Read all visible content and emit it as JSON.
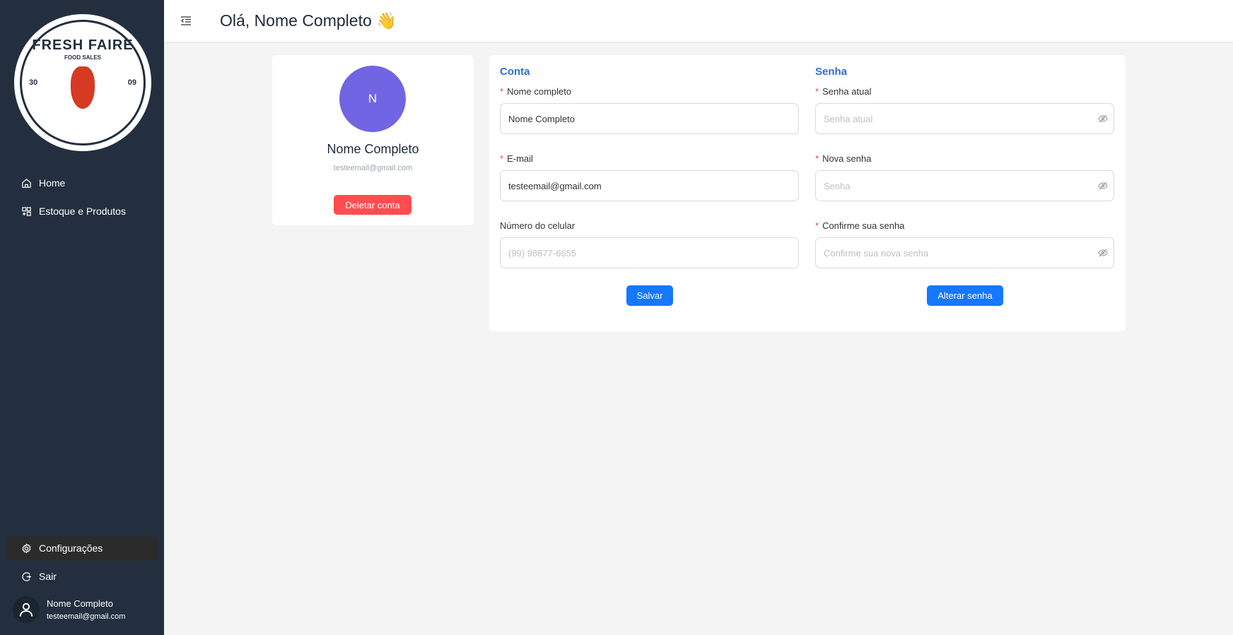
{
  "brand": {
    "logo_title": "FRESH FAIRE",
    "logo_subtitle": "FOOD SALES",
    "logo_left": "30",
    "logo_right": "09"
  },
  "sidebar": {
    "items": [
      {
        "label": "Home",
        "icon": "home-icon"
      },
      {
        "label": "Estoque e Produtos",
        "icon": "grid-icon"
      }
    ],
    "bottom": [
      {
        "label": "Configurações",
        "icon": "gear-icon",
        "active": true
      },
      {
        "label": "Sair",
        "icon": "logout-icon"
      }
    ],
    "user": {
      "name": "Nome Completo",
      "email": "testeemail@gmail.com"
    }
  },
  "header": {
    "greeting": "Olá, Nome Completo",
    "emoji": "👋"
  },
  "profile": {
    "initial": "N",
    "name": "Nome Completo",
    "email": "testeemail@gmail.com",
    "delete_label": "Deletar conta",
    "avatar_color": "#7265e3"
  },
  "account": {
    "heading": "Conta",
    "name_label": "Nome completo",
    "name_value": "Nome Completo",
    "email_label": "E-mail",
    "email_value": "testeemail@gmail.com",
    "phone_label": "Número do celular",
    "phone_placeholder": "(99) 98877-6655",
    "save_label": "Salvar"
  },
  "password": {
    "heading": "Senha",
    "current_label": "Senha atual",
    "current_placeholder": "Senha atual",
    "new_label": "Nova senha",
    "new_placeholder": "Senha",
    "confirm_label": "Confirme sua senha",
    "confirm_placeholder": "Confirme sua nova senha",
    "change_label": "Alterar senha"
  },
  "colors": {
    "primary": "#1677ff",
    "danger": "#ff4d4f",
    "sidebar": "#232f3e"
  }
}
